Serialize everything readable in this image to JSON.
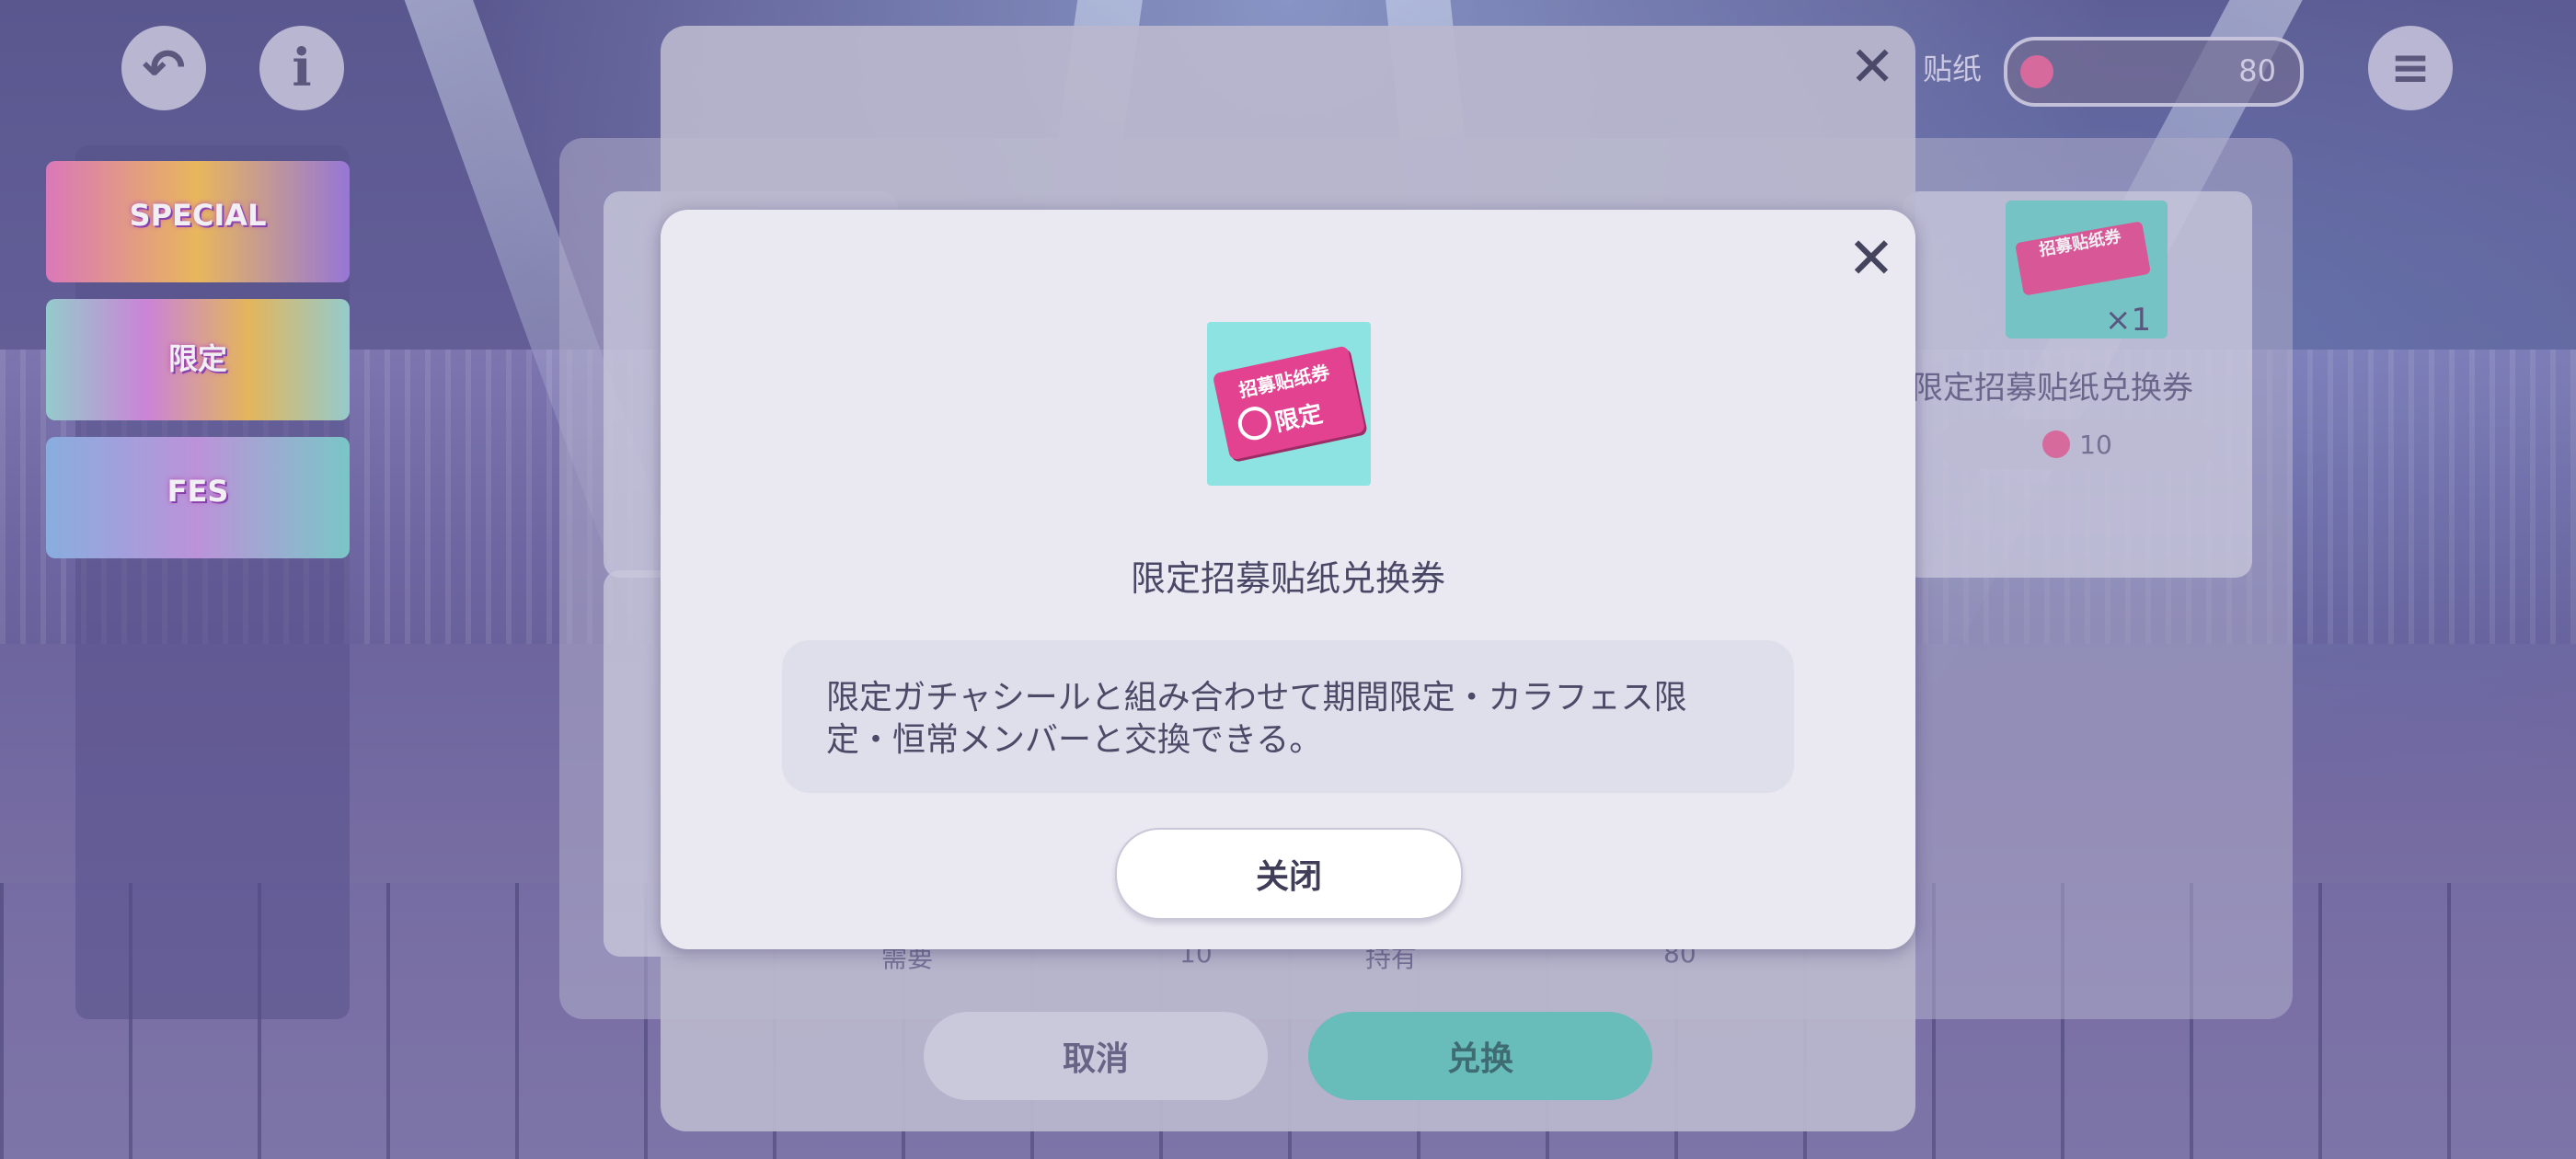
{
  "top_buttons": {
    "back_icon": "undo-arrow-icon",
    "info_icon": "info-icon",
    "menu_icon": "hamburger-menu-icon"
  },
  "counter": {
    "label": "贴纸",
    "value": "80"
  },
  "banners": [
    {
      "label": "SPECIAL"
    },
    {
      "label": "限定"
    },
    {
      "label": "FES"
    }
  ],
  "shop": {
    "card_right": {
      "name": "限定招募贴纸兑换券",
      "qty": "×1",
      "price": "10",
      "ticket_text": "招募贴纸券"
    },
    "row_left": {
      "label": "需要",
      "value": "10"
    },
    "row_right": {
      "label": "持有",
      "value": "80"
    }
  },
  "mid_dialog": {
    "cancel_label": "取消",
    "exchange_label": "兑换"
  },
  "modal": {
    "icon_line1": "招募贴纸券",
    "icon_line2": "限定",
    "item_name": "限定招募贴纸兑换券",
    "description": "限定ガチャシールと組み合わせて期間限定・カラフェス限定・恒常メンバーと交換できる。",
    "close_label": "关闭"
  },
  "colors": {
    "accent_teal": "#6cc7c0",
    "ticket_pink": "#e2428f",
    "modal_bg": "#eae9f1"
  }
}
